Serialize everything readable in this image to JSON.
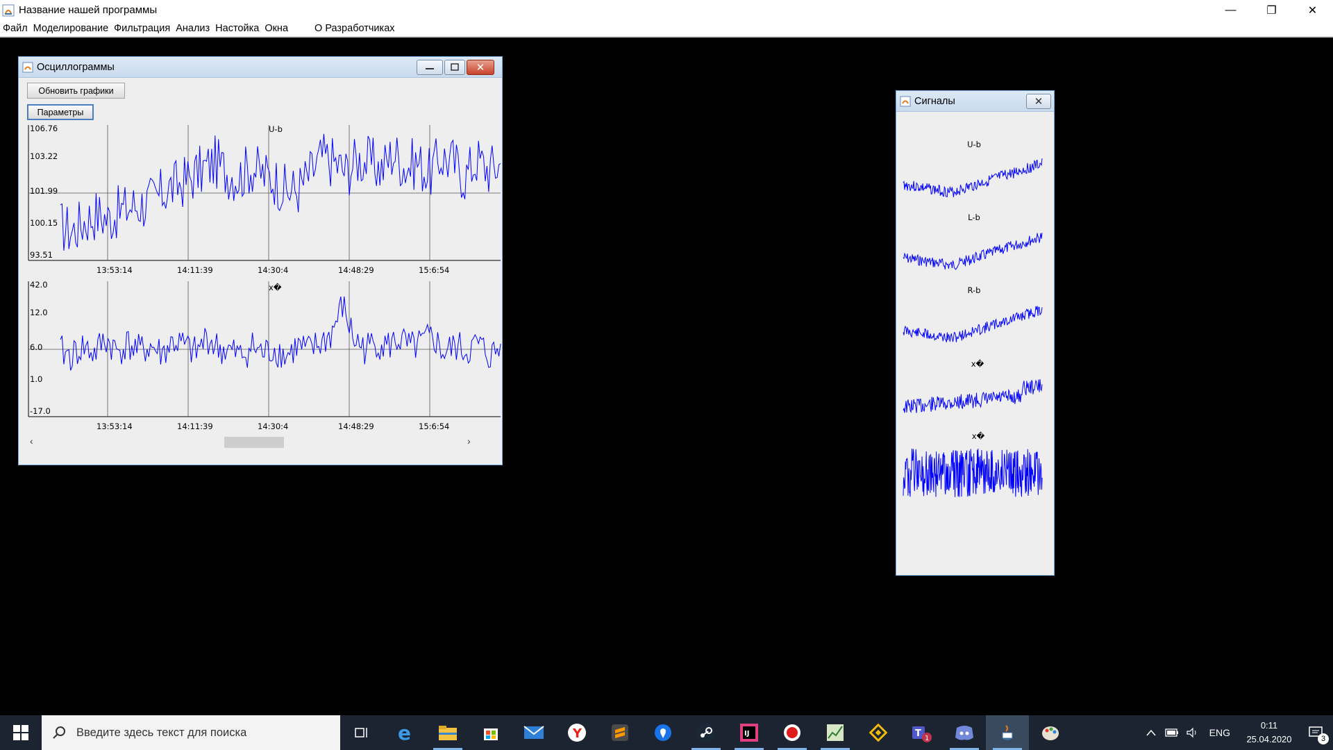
{
  "app": {
    "title": "Название нашей программы",
    "controls": {
      "minimize": "—",
      "maximize": "❐",
      "close": "✕"
    }
  },
  "menu": {
    "items": [
      "Файл",
      "Моделирование",
      "Фильтрация",
      "Анализ",
      "Настойка",
      "Окна"
    ],
    "about": "О Разработчиках"
  },
  "oscillograms_window": {
    "title": "Осциллограммы",
    "refresh_button": "Обновить графики",
    "params_button": "Параметры",
    "scroll_left": "‹",
    "scroll_right": "›"
  },
  "signals_window": {
    "title": "Сигналы",
    "labels": [
      "U-b",
      "L-b",
      "R-b",
      "x�",
      "x�"
    ]
  },
  "taskbar": {
    "search_placeholder": "Введите здесь текст для поиска",
    "lang": "ENG",
    "time": "0:11",
    "date": "25.04.2020",
    "notification_count": "3",
    "teams_badge": "1",
    "apps": [
      "task-view",
      "edge",
      "file-explorer",
      "store",
      "mail",
      "yandex",
      "sublime",
      "maps",
      "steam",
      "intellij",
      "recorder",
      "chart-app",
      "binance",
      "teams",
      "discord",
      "java",
      "paint"
    ]
  },
  "chart_data": [
    {
      "type": "line",
      "title": "U-b",
      "ytick_labels": [
        "106.76",
        "103.22",
        "101.99",
        "100.15",
        "93.51"
      ],
      "xtick_labels": [
        "13:53:14",
        "14:11:39",
        "14:30:4",
        "14:48:29",
        "15:6:54"
      ],
      "series": [
        {
          "color": "#0000ff",
          "values": [
            100.4,
            100.2,
            100.6,
            100.9,
            100.7,
            101.0,
            101.2,
            101.3,
            101.5,
            101.9,
            102.1,
            102.4,
            102.7,
            103.0,
            102.6,
            102.4,
            102.8,
            102.5,
            102.3,
            101.8,
            101.9,
            102.5,
            103.2,
            103.0,
            102.6,
            103.1,
            103.0,
            102.7,
            103.4,
            102.8,
            103.0,
            102.5,
            103.2,
            103.0,
            102.4,
            103.1,
            102.7,
            102.9
          ]
        }
      ],
      "ylim": [
        93.51,
        106.76
      ]
    },
    {
      "type": "line",
      "title": "x�",
      "ytick_labels": [
        "42.0",
        "12.0",
        "6.0",
        "1.0",
        "-17.0"
      ],
      "xtick_labels": [
        "13:53:14",
        "14:11:39",
        "14:30:4",
        "14:48:29",
        "15:6:54"
      ],
      "series": [
        {
          "color": "#0000ff",
          "values": [
            1.5,
            0.5,
            2.5,
            1.0,
            4.0,
            1.5,
            3.0,
            1.5,
            2.5,
            1.0,
            3.5,
            2.5,
            1.0,
            4.5,
            2.0,
            1.5,
            0.5,
            2.5,
            1.0,
            2.0,
            0.5,
            2.5,
            1.5,
            3.0,
            5.0,
            11.0,
            4.0,
            2.0,
            3.5,
            2.5,
            4.0,
            2.0,
            3.0,
            4.5,
            1.0,
            2.5,
            1.5,
            3.0,
            0.5,
            2.0
          ]
        }
      ],
      "ylim": [
        -17.0,
        42.0
      ]
    }
  ]
}
